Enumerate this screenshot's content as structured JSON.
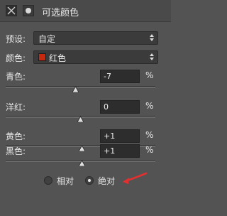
{
  "header": {
    "title": "可选颜色"
  },
  "preset": {
    "label": "预设:",
    "value": "自定"
  },
  "colors": {
    "label": "颜色:",
    "value": "红色",
    "swatch_color": "#c8290e"
  },
  "sliders": [
    {
      "label": "青色:",
      "value": "-7",
      "unit": "%"
    },
    {
      "label": "洋红:",
      "value": "0",
      "unit": "%"
    },
    {
      "label": "黄色:",
      "value": "+1",
      "unit": "%"
    },
    {
      "label": "黑色:",
      "value": "+1",
      "unit": "%"
    }
  ],
  "method": {
    "relative_label": "相对",
    "absolute_label": "绝对",
    "selected": "absolute"
  },
  "annotation": {
    "arrow_color": "#e03030"
  }
}
